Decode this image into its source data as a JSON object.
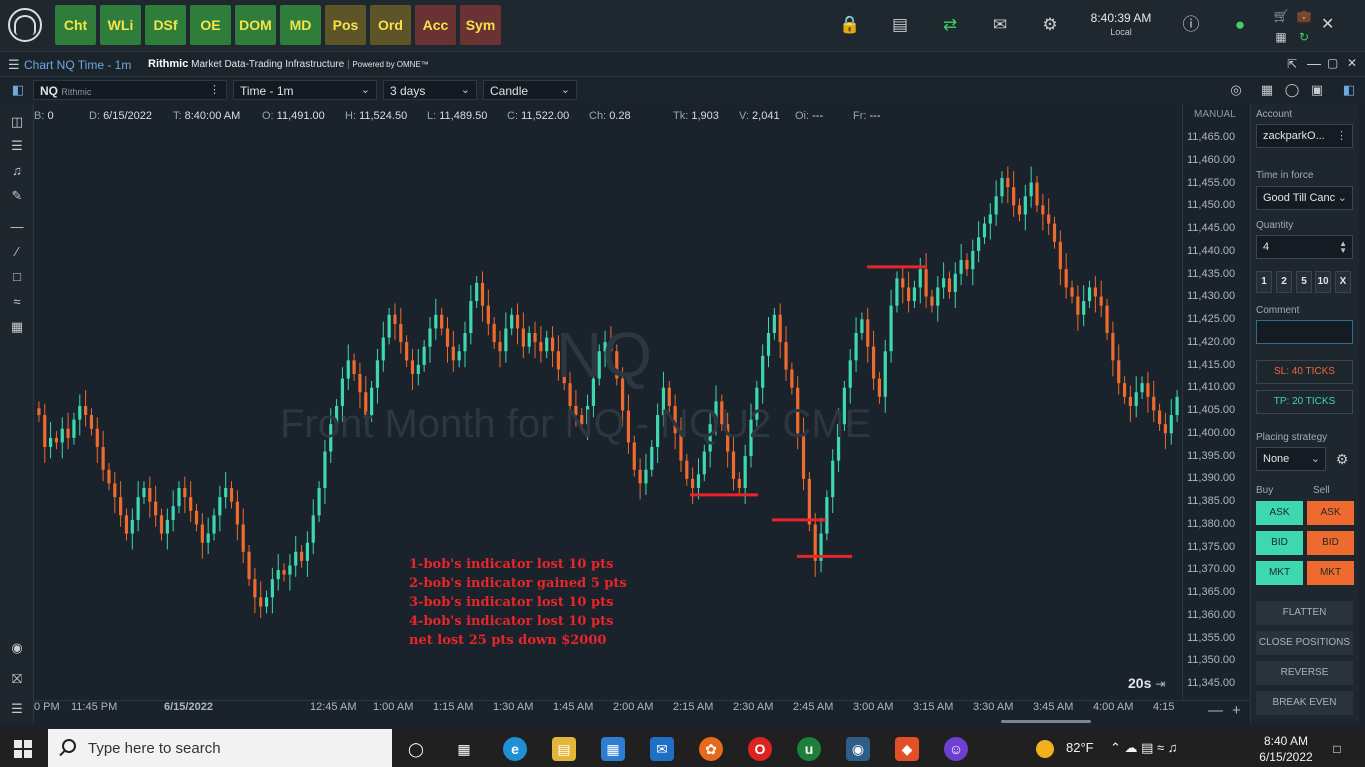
{
  "toolbar": {
    "modules": [
      {
        "label": "Cht",
        "style": "green"
      },
      {
        "label": "WLi",
        "style": "green"
      },
      {
        "label": "DSf",
        "style": "green"
      },
      {
        "label": "OE",
        "style": "green"
      },
      {
        "label": "DOM",
        "style": "green"
      },
      {
        "label": "MD",
        "style": "green"
      },
      {
        "label": "Pos",
        "style": "olive"
      },
      {
        "label": "Ord",
        "style": "olive"
      },
      {
        "label": "Acc",
        "style": "red"
      },
      {
        "label": "Sym",
        "style": "red"
      }
    ],
    "clock_time": "8:40:39 AM",
    "clock_zone": "Local"
  },
  "chart_window": {
    "title": "Chart NQ Time - 1m",
    "provider_brand": "Rithmic",
    "provider_tagline": "Market Data-Trading Infrastructure",
    "powered_by": "Powered by OMNE™"
  },
  "selectors": {
    "symbol": "NQ",
    "symbol_source": "Rithmic",
    "timeframe": "Time - 1m",
    "range": "3 days",
    "chart_style": "Candle"
  },
  "info_line": [
    {
      "label": "B:",
      "value": "0"
    },
    {
      "label": "D:",
      "value": "6/15/2022"
    },
    {
      "label": "T:",
      "value": "8:40:00 AM"
    },
    {
      "label": "O:",
      "value": "11,491.00"
    },
    {
      "label": "H:",
      "value": "11,524.50"
    },
    {
      "label": "L:",
      "value": "11,489.50"
    },
    {
      "label": "C:",
      "value": "11,522.00"
    },
    {
      "label": "Ch:",
      "value": "0.28"
    },
    {
      "label": "Tk:",
      "value": "1,903"
    },
    {
      "label": "V:",
      "value": "2,041"
    },
    {
      "label": "Oi:",
      "value": "---"
    },
    {
      "label": "Fr:",
      "value": "---"
    }
  ],
  "watermark": {
    "symbol": "NQ",
    "description": "Front Month for NQ - NQU2 CME"
  },
  "annotations": {
    "notes": [
      "1-bob's indicator lost 10 pts",
      "2-bob's indicator gained 5 pts",
      "3-bob's indicator lost 10 pts",
      "4-bob's indicator lost 10 pts",
      "net lost 25 pts down $2000"
    ],
    "line_color": "#e8262a"
  },
  "price_axis": {
    "mode": "MANUAL",
    "labels": [
      "11,465.00",
      "11,460.00",
      "11,455.00",
      "11,450.00",
      "11,445.00",
      "11,440.00",
      "11,435.00",
      "11,430.00",
      "11,425.00",
      "11,420.00",
      "11,415.00",
      "11,410.00",
      "11,405.00",
      "11,400.00",
      "11,395.00",
      "11,390.00",
      "11,385.00",
      "11,380.00",
      "11,375.00",
      "11,370.00",
      "11,365.00",
      "11,360.00",
      "11,355.00",
      "11,350.00",
      "11,345.00"
    ]
  },
  "time_axis": {
    "labels": [
      "0 PM",
      "11:45 PM",
      "6/15/2022",
      "12:45 AM",
      "1:00 AM",
      "1:15 AM",
      "1:30 AM",
      "1:45 AM",
      "2:00 AM",
      "2:15 AM",
      "2:30 AM",
      "2:45 AM",
      "3:00 AM",
      "3:15 AM",
      "3:30 AM",
      "3:45 AM",
      "4:00 AM",
      "4:15"
    ],
    "speed_label": "20s"
  },
  "chart_data": {
    "type": "candlestick",
    "title": "",
    "xlabel": "",
    "ylabel": "",
    "ylim": [
      11345,
      11467
    ],
    "colors": {
      "up": "#3dd7b0",
      "down": "#ef6a2e",
      "background": "#1a222b"
    },
    "closes": [
      11404,
      11397,
      11399,
      11398,
      11401,
      11399,
      11403,
      11406,
      11404,
      11401,
      11397,
      11392,
      11389,
      11386,
      11382,
      11378,
      11381,
      11386,
      11388,
      11385,
      11382,
      11378,
      11381,
      11384,
      11388,
      11386,
      11383,
      11380,
      11376,
      11378,
      11382,
      11386,
      11388,
      11385,
      11380,
      11374,
      11368,
      11364,
      11362,
      11364,
      11368,
      11370,
      11369,
      11371,
      11374,
      11372,
      11376,
      11382,
      11388,
      11396,
      11402,
      11406,
      11412,
      11416,
      11413,
      11409,
      11404,
      11410,
      11416,
      11421,
      11426,
      11424,
      11420,
      11416,
      11413,
      11415,
      11419,
      11423,
      11426,
      11423,
      11419,
      11416,
      11418,
      11422,
      11429,
      11433,
      11428,
      11424,
      11420,
      11418,
      11423,
      11426,
      11423,
      11419,
      11422,
      11420,
      11418,
      11421,
      11418,
      11414,
      11411,
      11406,
      11404,
      11402,
      11406,
      11412,
      11418,
      11420,
      11418,
      11412,
      11405,
      11398,
      11392,
      11389,
      11392,
      11397,
      11404,
      11410,
      11406,
      11400,
      11394,
      11390,
      11388,
      11391,
      11396,
      11402,
      11407,
      11402,
      11396,
      11390,
      11388,
      11395,
      11403,
      11410,
      11417,
      11422,
      11426,
      11420,
      11414,
      11410,
      11400,
      11390,
      11380,
      11372,
      11378,
      11386,
      11394,
      11402,
      11410,
      11416,
      11422,
      11425,
      11419,
      11412,
      11408,
      11418,
      11428,
      11434,
      11432,
      11429,
      11432,
      11436,
      11430,
      11428,
      11432,
      11434,
      11431,
      11435,
      11438,
      11436,
      11440,
      11443,
      11446,
      11448,
      11452,
      11456,
      11454,
      11450,
      11448,
      11452,
      11455,
      11450,
      11448,
      11446,
      11442,
      11436,
      11432,
      11430,
      11426,
      11429,
      11432,
      11430,
      11428,
      11422,
      11416,
      11411,
      11408,
      11406,
      11409,
      11411,
      11408,
      11405,
      11402,
      11400,
      11404,
      11408
    ]
  }
}
